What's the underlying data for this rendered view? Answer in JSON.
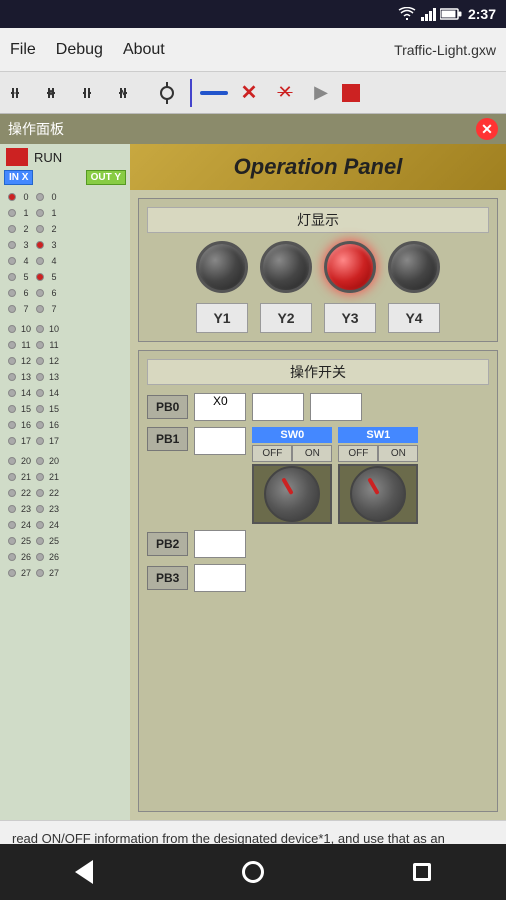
{
  "statusBar": {
    "time": "2:37",
    "icons": [
      "wifi",
      "signal",
      "battery"
    ]
  },
  "menuBar": {
    "items": [
      "File",
      "Debug",
      "About"
    ],
    "title": "Traffic-Light.gxw"
  },
  "toolbar": {
    "icons": [
      "ladder-icon1",
      "ladder-icon2",
      "ladder-icon3",
      "ladder-icon4",
      "coil-icon",
      "divider",
      "line",
      "x-mark1",
      "x-mark2",
      "play",
      "stop"
    ]
  },
  "ioPanel": {
    "runLabel": "RUN",
    "headerIn": "IN X",
    "headerOut": "OUT Y",
    "rows0_7": [
      {
        "num": "0",
        "inActive": true,
        "outActive": false
      },
      {
        "num": "1",
        "inActive": false,
        "outActive": false
      },
      {
        "num": "2",
        "inActive": false,
        "outActive": false
      },
      {
        "num": "3",
        "inActive": false,
        "outActive": true
      },
      {
        "num": "4",
        "inActive": false,
        "outActive": false
      },
      {
        "num": "5",
        "inActive": false,
        "outActive": true
      },
      {
        "num": "6",
        "inActive": false,
        "outActive": false
      },
      {
        "num": "7",
        "inActive": false,
        "outActive": false
      }
    ],
    "rows10_17": [
      {
        "num": "10"
      },
      {
        "num": "11"
      },
      {
        "num": "12"
      },
      {
        "num": "13"
      },
      {
        "num": "14"
      },
      {
        "num": "15"
      },
      {
        "num": "16"
      },
      {
        "num": "17"
      }
    ],
    "rows20_27": [
      {
        "num": "20"
      },
      {
        "num": "21"
      },
      {
        "num": "22"
      },
      {
        "num": "23"
      },
      {
        "num": "24"
      },
      {
        "num": "25"
      },
      {
        "num": "26"
      },
      {
        "num": "27"
      }
    ]
  },
  "panelTitle": "操作面板",
  "operationPanel": {
    "header": "Operation Panel",
    "lightSection": {
      "label": "灯显示",
      "lights": [
        {
          "id": "L1",
          "active": false
        },
        {
          "id": "L2",
          "active": false
        },
        {
          "id": "L3",
          "active": true
        },
        {
          "id": "L4",
          "active": false
        }
      ],
      "labels": [
        "Y1",
        "Y2",
        "Y3",
        "Y4"
      ]
    },
    "switchSection": {
      "label": "操作开关",
      "rows": [
        {
          "pb": "PB0",
          "input": "X0",
          "right1": "",
          "right2": ""
        },
        {
          "pb": "PB1",
          "input": "",
          "sw0label": "SW0",
          "sw1label": "SW1"
        },
        {
          "pb": "PB2",
          "input": ""
        },
        {
          "pb": "PB3",
          "input": ""
        }
      ],
      "sw0": {
        "label": "SW0",
        "off": "OFF",
        "on": "ON"
      },
      "sw1": {
        "label": "SW1",
        "off": "OFF",
        "on": "ON"
      }
    }
  },
  "bottomText": "read ON/OFF information from the designated device*1, and use that as an operation result.",
  "navbar": {
    "back": "◀",
    "home": "●",
    "square": "■"
  }
}
